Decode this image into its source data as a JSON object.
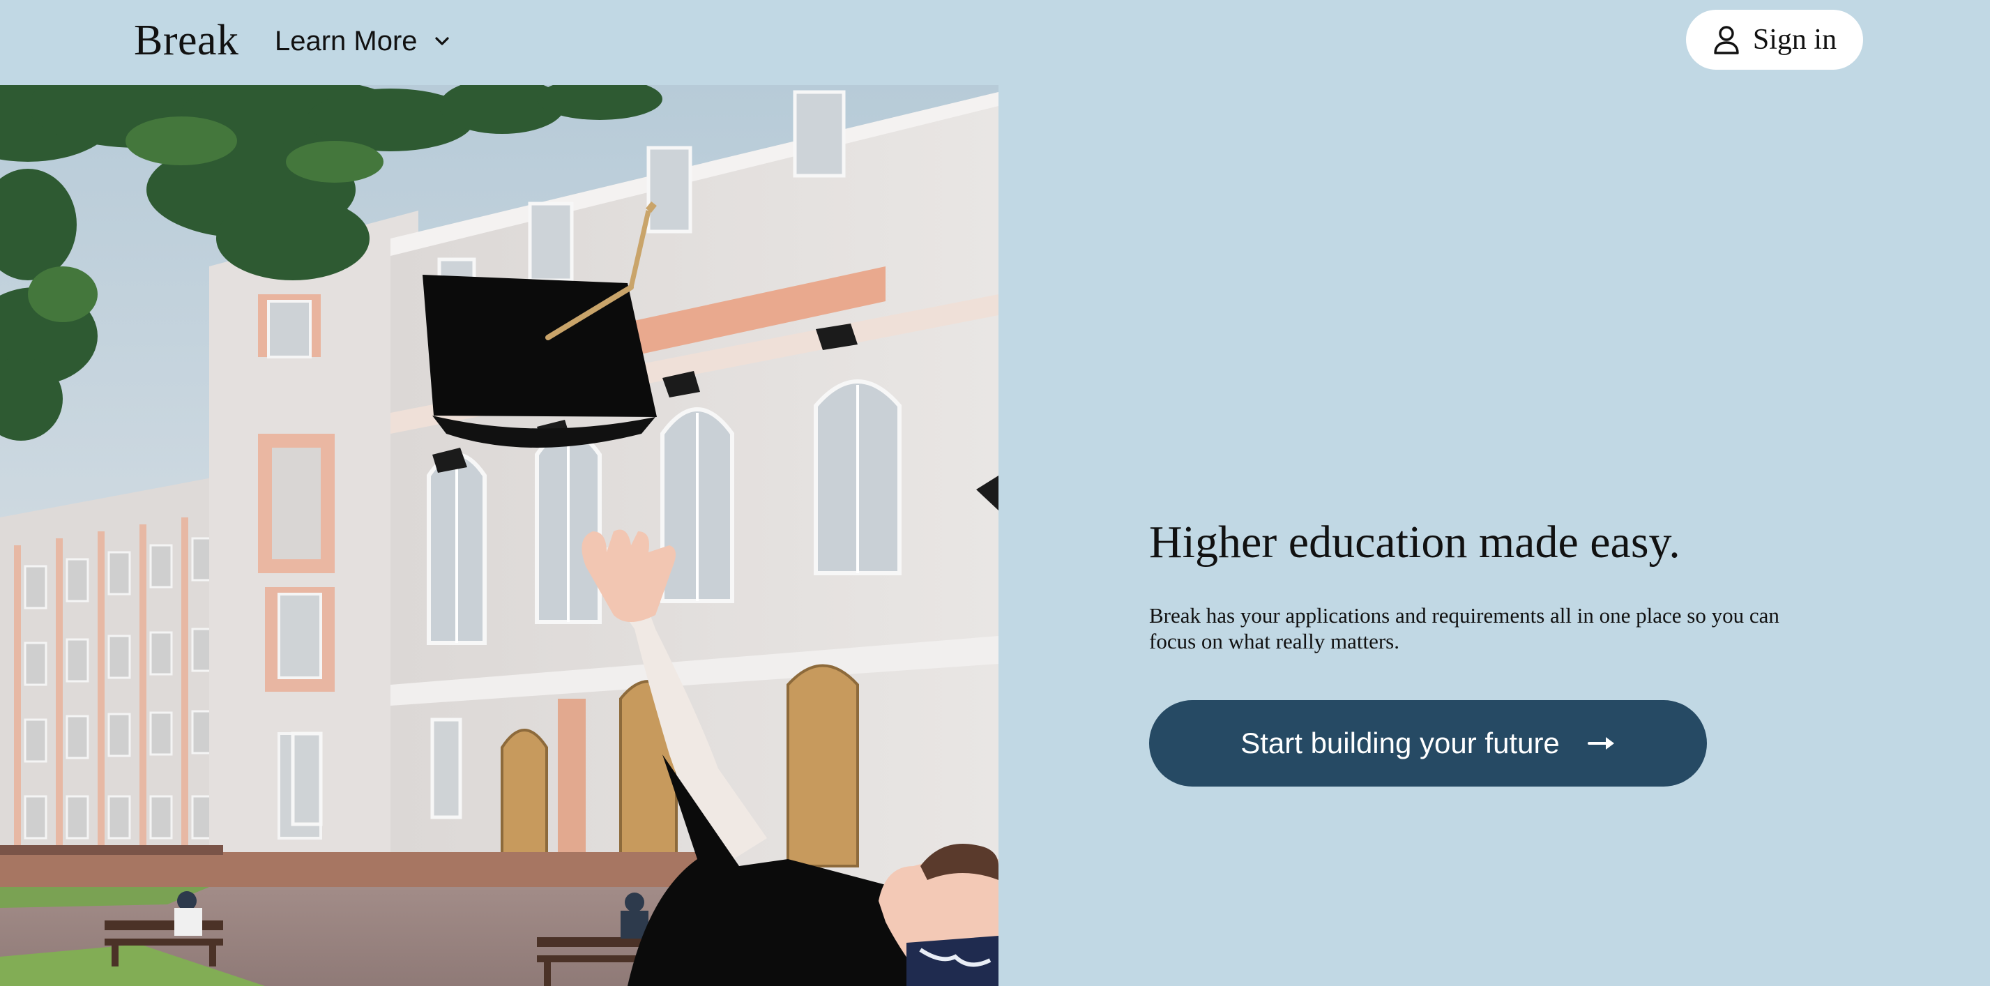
{
  "header": {
    "brand": "Break",
    "learn_more_label": "Learn More",
    "signin_label": "Sign in"
  },
  "hero": {
    "image_name": "graduation-photo",
    "headline": "Higher education made easy.",
    "subcopy": "Break has your applications and requirements all in one place so you can focus on what really matters.",
    "cta_label": "Start building your future"
  },
  "icons": {
    "learn_more": "chevron-down-icon",
    "signin": "user-icon",
    "cta": "arrow-right-icon"
  },
  "colors": {
    "background": "#c1d8e4",
    "cta_background": "#264a64",
    "cta_text": "#ffffff",
    "signin_background": "#ffffff",
    "text": "#111111"
  }
}
